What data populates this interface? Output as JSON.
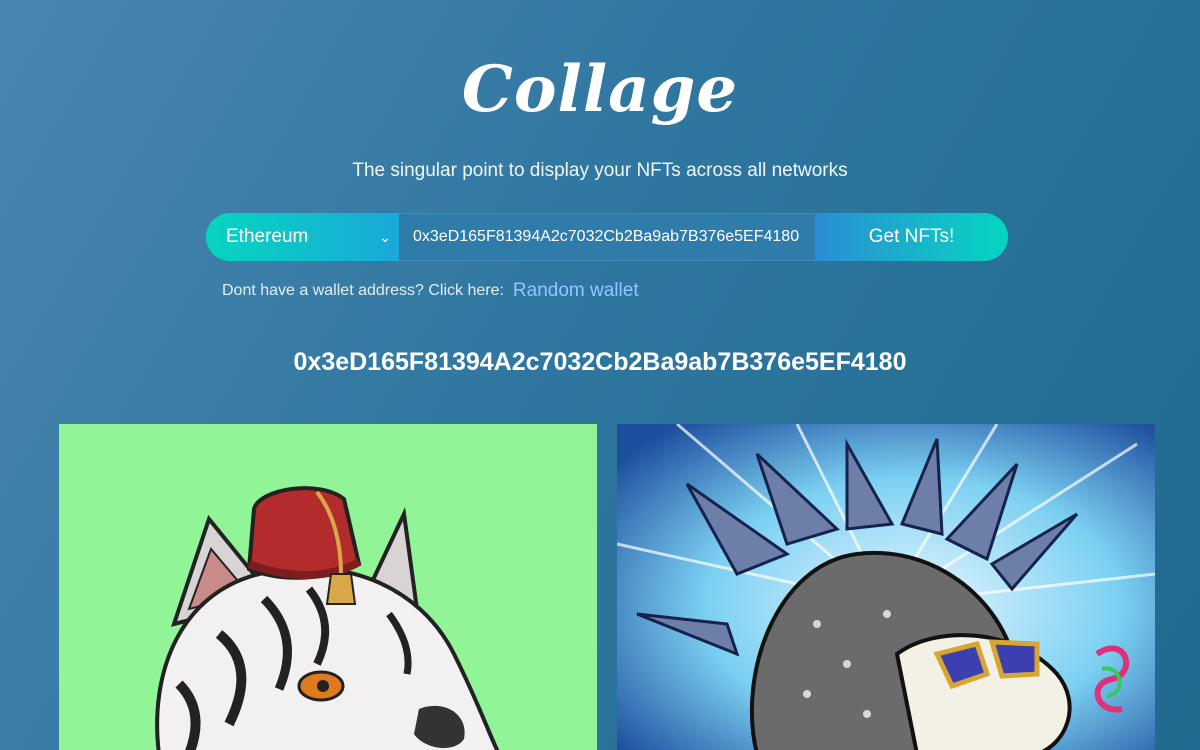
{
  "app": {
    "logo_text": "Collage",
    "tagline": "The singular point to display your NFTs across all networks"
  },
  "form": {
    "network_selected": "Ethereum",
    "address_value": "0x3eD165F81394A2c7032Cb2Ba9ab7B376e5EF4180",
    "submit_label": "Get NFTs!"
  },
  "helper": {
    "prompt": "Dont have a wallet address? Click here:",
    "link_label": "Random wallet"
  },
  "wallet": {
    "address": "0x3eD165F81394A2c7032Cb2Ba9ab7B376e5EF4180"
  },
  "nfts": [
    {
      "description": "white tiger wearing red fez",
      "background": "#91f598"
    },
    {
      "description": "spiky hedgehog with sunglasses",
      "background": "#5ab6e6"
    }
  ],
  "icons": {
    "select_arrow": "chevron-down-icon"
  },
  "colors": {
    "accent_teal": "#05d6c0",
    "accent_blue": "#2b8ed4",
    "link": "#8fc8ff"
  }
}
